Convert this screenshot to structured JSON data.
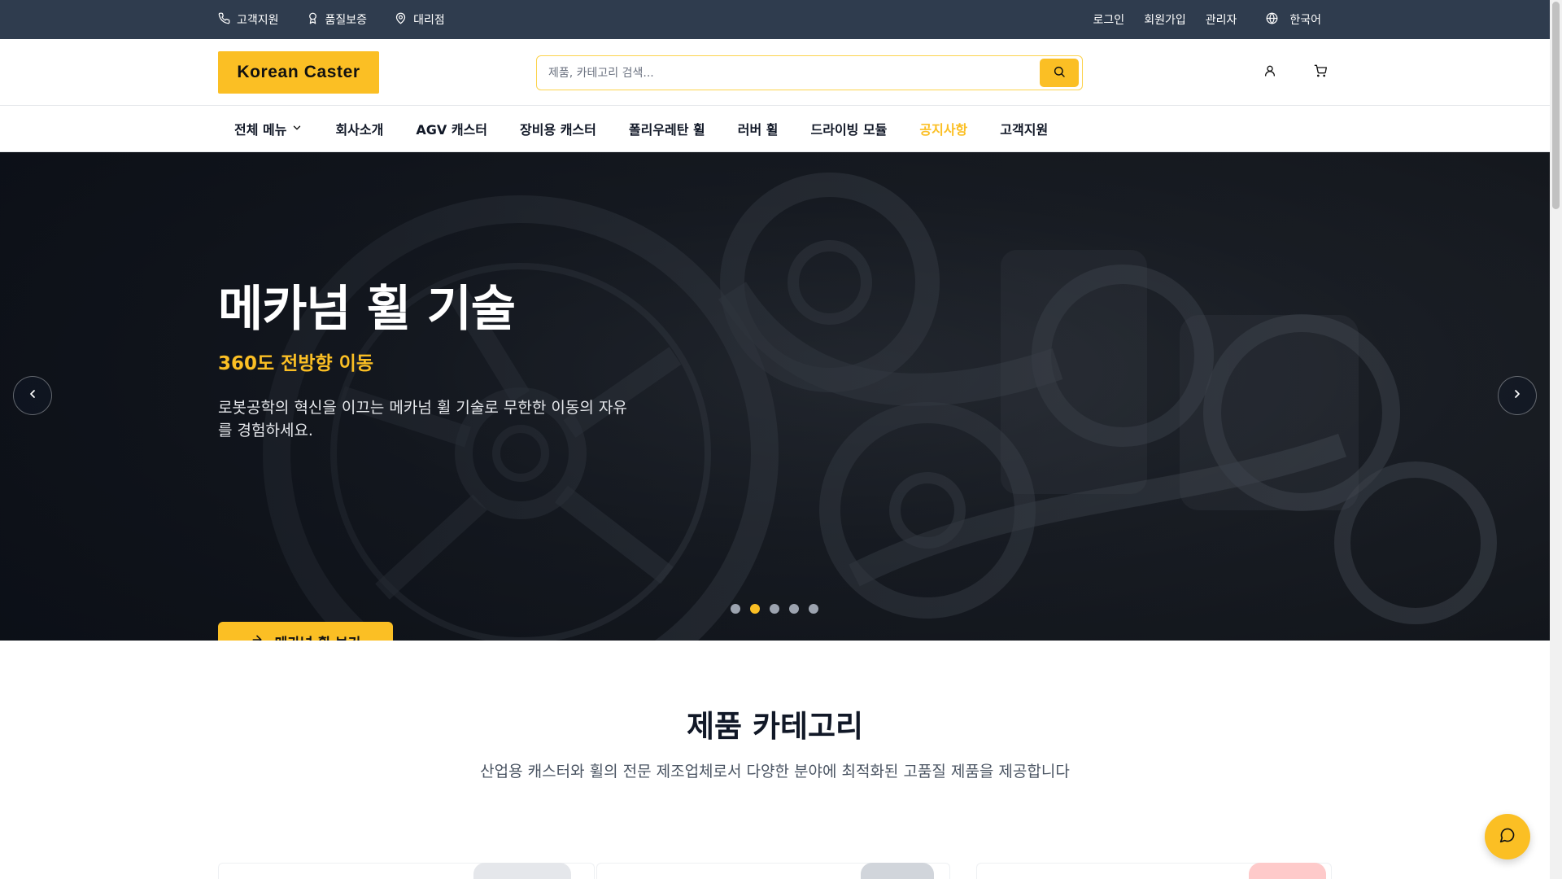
{
  "topbar": {
    "support": "고객지원",
    "quality": "품질보증",
    "dealer": "대리점",
    "login": "로그인",
    "signup": "회원가입",
    "admin": "관리자",
    "language": "한국어"
  },
  "header": {
    "logo": "Korean Caster",
    "search_placeholder": "제품, 카테고리 검색...",
    "icons": [
      "search-icon",
      "user-icon",
      "cart-icon"
    ]
  },
  "nav": {
    "items": [
      {
        "label": "전체 메뉴"
      },
      {
        "label": "회사소개"
      },
      {
        "label": "AGV 캐스터"
      },
      {
        "label": "장비용 캐스터"
      },
      {
        "label": "폴리우레탄 휠"
      },
      {
        "label": "러버 휠"
      },
      {
        "label": "드라이빙 모듈"
      },
      {
        "label": "공지사항"
      },
      {
        "label": "고객지원"
      }
    ],
    "active_index": 7
  },
  "hero": {
    "title": "메카넘 휠 기술",
    "subtitle": "360도 전방향 이동",
    "description": "로봇공학의 혁신을 이끄는 메카넘 휠 기술로 무한한 이동의 자유를 경험하세요.",
    "cta": "메카넘 휠 보기",
    "slide_count": 5,
    "active_slide": 2
  },
  "categories": {
    "title": "제품 카테고리",
    "description": "산업용 캐스터와 휠의 전문 제조업체로서 다양한 분야에 최적화된 고품질 제품을 제공합니다"
  },
  "colors": {
    "accent": "#fbbf24",
    "topbar": "#2f3c4e",
    "text": "#111827"
  }
}
